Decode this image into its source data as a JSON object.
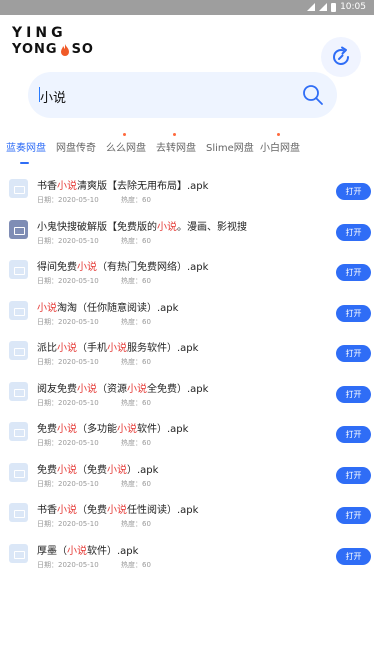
{
  "status_bar": {
    "time": "10:05"
  },
  "logo": {
    "line1": "YING",
    "line2_left": "YONG",
    "line2_right": "SO"
  },
  "search": {
    "value": "小说"
  },
  "tabs": [
    {
      "label": "蓝奏网盘",
      "active": true,
      "dot": false
    },
    {
      "label": "网盘传奇",
      "active": false,
      "dot": false
    },
    {
      "label": "么么网盘",
      "active": false,
      "dot": true
    },
    {
      "label": "去转网盘",
      "active": false,
      "dot": true
    },
    {
      "label": "Slime网盘",
      "active": false,
      "dot": false
    },
    {
      "label": "小白网盘",
      "active": false,
      "dot": true
    }
  ],
  "results": [
    {
      "parts": [
        "书香",
        "小说",
        "清爽版【去除无用布局】.apk"
      ],
      "date": "日期：2020-05-10",
      "heat": "热度：60",
      "button": "打开",
      "icon": "file"
    },
    {
      "parts": [
        "小鬼快搜破解版【免费版的",
        "小说",
        "。漫画、影视搜"
      ],
      "date": "日期：2020-05-10",
      "heat": "热度：60",
      "button": "打开",
      "icon": "cloud"
    },
    {
      "parts": [
        "得间免费",
        "小说",
        "（有热门免费网络）.apk"
      ],
      "date": "日期：2020-05-10",
      "heat": "热度：60",
      "button": "打开",
      "icon": "file"
    },
    {
      "parts": [
        "",
        "小说",
        "淘淘（任你随意阅读）.apk"
      ],
      "date": "日期：2020-05-10",
      "heat": "热度：60",
      "button": "打开",
      "icon": "file"
    },
    {
      "parts": [
        "派比",
        "小说",
        "（手机",
        "小说",
        "服务软件）.apk"
      ],
      "date": "日期：2020-05-10",
      "heat": "热度：60",
      "button": "打开",
      "icon": "file"
    },
    {
      "parts": [
        "阅友免费",
        "小说",
        "（资源",
        "小说",
        "全免费）.apk"
      ],
      "date": "日期：2020-05-10",
      "heat": "热度：60",
      "button": "打开",
      "icon": "file"
    },
    {
      "parts": [
        "免费",
        "小说",
        "（多功能",
        "小说",
        "软件）.apk"
      ],
      "date": "日期：2020-05-10",
      "heat": "热度：60",
      "button": "打开",
      "icon": "file"
    },
    {
      "parts": [
        "免费",
        "小说",
        "（免费",
        "小说",
        "）.apk"
      ],
      "date": "日期：2020-05-10",
      "heat": "热度：60",
      "button": "打开",
      "icon": "file"
    },
    {
      "parts": [
        "书香",
        "小说",
        "（免费",
        "小说",
        "任性阅读）.apk"
      ],
      "date": "日期：2020-05-10",
      "heat": "热度：60",
      "button": "打开",
      "icon": "file"
    },
    {
      "parts": [
        "厚墨（",
        "小说",
        "软件）.apk"
      ],
      "date": "日期：2020-05-10",
      "heat": "热度：60",
      "button": "打开",
      "icon": "file"
    }
  ],
  "colors": {
    "accent": "#2f6df6",
    "highlight": "#e53935",
    "search_bg": "#eef4ff"
  }
}
